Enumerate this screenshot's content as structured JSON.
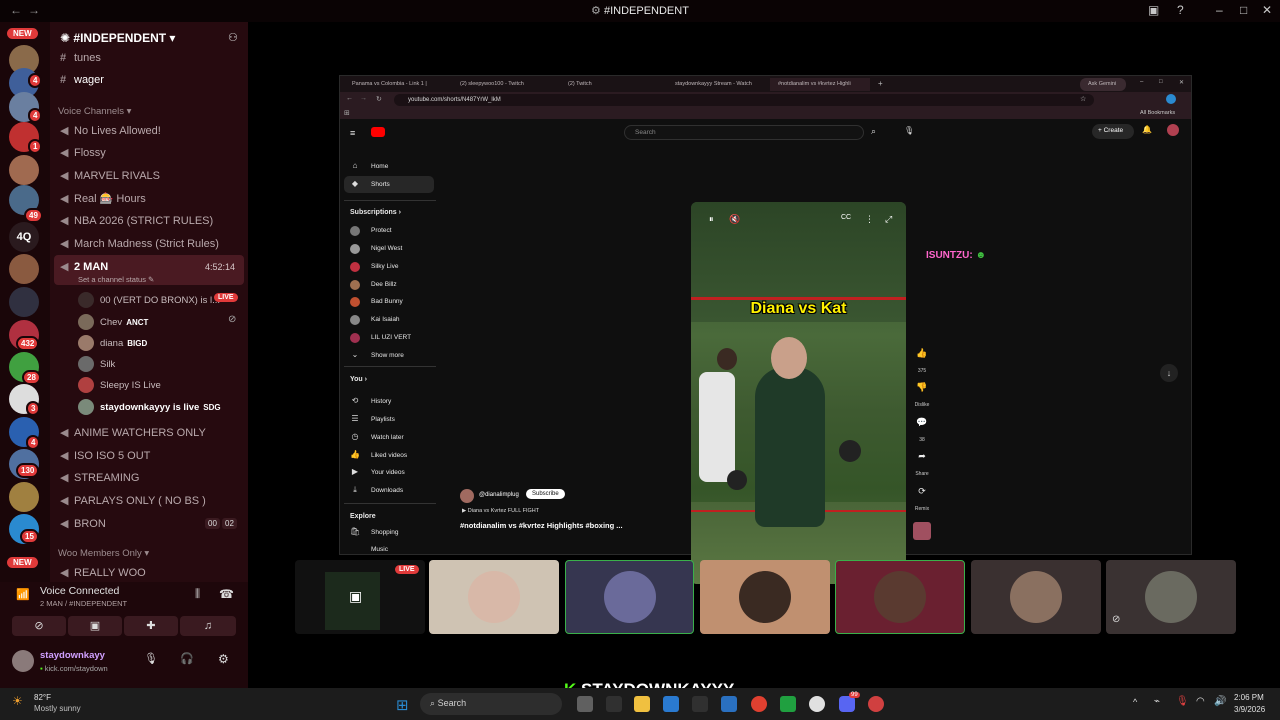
{
  "window": {
    "title": "#INDEPENDENT"
  },
  "rail": {
    "new_top": "NEW",
    "new_bottom": "NEW",
    "text_server": "4Q",
    "badges": [
      "4",
      "4",
      "1",
      "49",
      "432",
      "28",
      "3",
      "4",
      "130",
      "15"
    ]
  },
  "sidebar": {
    "server_name": "#INDEPENDENT",
    "text_channels": [
      "tunes",
      "wager"
    ],
    "voice_section": "Voice Channels",
    "voice_channels_top": [
      "No Lives Allowed!",
      "Flossy",
      "MARVEL RIVALS",
      "Real 🎰 Hours",
      "NBA 2026 (STRICT RULES)",
      "March Madness (Strict Rules)"
    ],
    "active_channel": {
      "name": "2 MAN",
      "timer": "4:52:14",
      "status": "Set a channel status"
    },
    "members": [
      {
        "name": "00 (VERT DO BRONX) is l...",
        "tag": "LIVE"
      },
      {
        "name": "Chev",
        "tag": "ANCT"
      },
      {
        "name": "diana",
        "tag": "BIGD"
      },
      {
        "name": "Silk",
        "tag": ""
      },
      {
        "name": "Sleepy IS Live",
        "tag": ""
      },
      {
        "name": "staydownkayyy is live",
        "tag": "SDG"
      }
    ],
    "voice_channels_bottom": [
      "ANIME WATCHERS ONLY",
      "ISO ISO 5 OUT",
      "STREAMING",
      "PARLAYS ONLY ( NO BS )",
      "BRON"
    ],
    "bron_counts": [
      "00",
      "02"
    ],
    "woo_section": "Woo Members Only",
    "woo_channel": "REALLY WOO"
  },
  "voice_panel": {
    "status": "Voice Connected",
    "channel": "2 MAN / #INDEPENDENT",
    "username": "staydownkayy",
    "substatus": "kick.com/staydown"
  },
  "browser": {
    "tabs": [
      "Panama vs Colombia - Link 1 |",
      "(2) sleepywoo100 - Twitch",
      "(2) Twitch",
      "staydownkayyy Stream - Watch",
      "#notdianalim vs #kvrtez Highli"
    ],
    "ask_gemini": "Ask Gemini",
    "url": "youtube.com/shorts/N487YrW_lkM",
    "bookmarks": "All Bookmarks"
  },
  "youtube": {
    "search_placeholder": "Search",
    "create_label": "Create",
    "nav": [
      "Home",
      "Shorts"
    ],
    "subscriptions_label": "Subscriptions",
    "subscriptions": [
      "Protect",
      "Nigel West",
      "Silky Live",
      "Dee Billz",
      "Bad Bunny",
      "Kai Isaiah",
      "LIL UZI VERT"
    ],
    "show_more": "Show more",
    "you_label": "You",
    "you_items": [
      "History",
      "Playlists",
      "Watch later",
      "Liked videos",
      "Your videos",
      "Downloads"
    ],
    "explore_label": "Explore",
    "explore_items": [
      "Shopping",
      "Music"
    ],
    "channel_handle": "@dianalimplug",
    "subscribe_label": "Subscribe",
    "full_fight": "Diana vs Kvrtez FULL FIGHT",
    "video_title": "#notdianalim vs #kvrtez Highlights #boxing ...",
    "overlay_text": "Diana vs Kat",
    "side_stats": {
      "likes": "375",
      "dislike": "Dislike",
      "comments": "38",
      "share": "Share",
      "remix": "Remix"
    },
    "chat_overlay": "ISUNTZU:"
  },
  "stream": {
    "live_badge": "LIVE",
    "streamer": "STAYDOWNKAYYY"
  },
  "taskbar": {
    "weather_temp": "82°F",
    "weather_desc": "Mostly sunny",
    "search_label": "Search",
    "time": "2:06 PM",
    "date": "3/9/2026",
    "discord_badge": "99"
  }
}
